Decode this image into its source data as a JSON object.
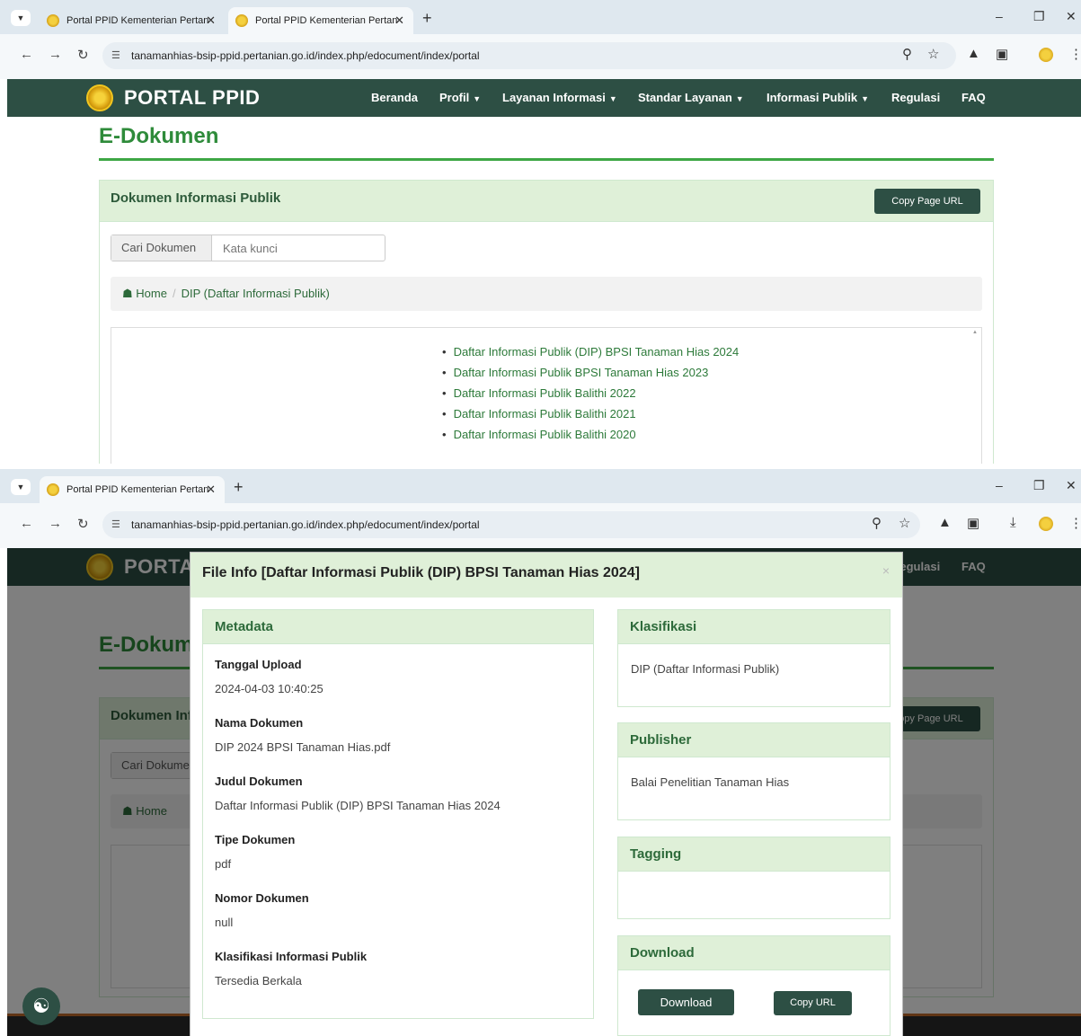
{
  "browser": {
    "tab_inactive_title": "Portal PPID Kementerian Pertan",
    "tab_active_title": "Portal PPID Kementerian Pertan",
    "new_tab": "+",
    "url": "tanamanhias-bsip-ppid.pertanian.go.id/index.php/edocument/index/portal",
    "minimize": "–",
    "restore": "❐",
    "close": "✕",
    "tab_close": "✕"
  },
  "header": {
    "brand": "PORTAL PPID",
    "menu": [
      {
        "label": "Beranda",
        "dropdown": false
      },
      {
        "label": "Profil",
        "dropdown": true
      },
      {
        "label": "Layanan Informasi",
        "dropdown": true
      },
      {
        "label": "Standar Layanan",
        "dropdown": true
      },
      {
        "label": "Informasi Publik",
        "dropdown": true
      },
      {
        "label": "Regulasi",
        "dropdown": false
      },
      {
        "label": "FAQ",
        "dropdown": false
      }
    ]
  },
  "page": {
    "title": "E-Dokumen",
    "panel_title": "Dokumen Informasi Publik",
    "copy_page_url": "Copy Page URL",
    "search_addon": "Cari Dokumen",
    "search_placeholder": "Kata kunci",
    "breadcrumb_home": "Home",
    "breadcrumb_current": "DIP (Daftar Informasi Publik)",
    "documents": [
      "Daftar Informasi Publik (DIP) BPSI Tanaman Hias 2024",
      "Daftar Informasi Publik BPSI Tanaman Hias 2023",
      "Daftar Informasi Publik Balithi 2022",
      "Daftar Informasi Publik Balithi 2021",
      "Daftar Informasi Publik Balithi 2020"
    ]
  },
  "modal": {
    "title": "File Info [Daftar Informasi Publik (DIP) BPSI Tanaman Hias 2024]",
    "close": "×",
    "metadata_title": "Metadata",
    "fields": [
      {
        "label": "Tanggal Upload",
        "value": "2024-04-03 10:40:25"
      },
      {
        "label": "Nama Dokumen",
        "value": "DIP 2024 BPSI Tanaman Hias.pdf"
      },
      {
        "label": "Judul Dokumen",
        "value": "Daftar Informasi Publik (DIP) BPSI Tanaman Hias 2024"
      },
      {
        "label": "Tipe Dokumen",
        "value": "pdf"
      },
      {
        "label": "Nomor Dokumen",
        "value": "null"
      },
      {
        "label": "Klasifikasi Informasi Publik",
        "value": "Tersedia Berkala"
      }
    ],
    "klasifikasi_title": "Klasifikasi",
    "klasifikasi_value": "DIP (Daftar Informasi Publik)",
    "publisher_title": "Publisher",
    "publisher_value": "Balai Penelitian Tanaman Hias",
    "tagging_title": "Tagging",
    "download_title": "Download",
    "download_button": "Download",
    "copy_url_button": "Copy URL"
  },
  "colors": {
    "header_bg": "#2d4f44",
    "accent_green": "#2e8b3a",
    "panel_head_bg": "#dff0d8"
  }
}
